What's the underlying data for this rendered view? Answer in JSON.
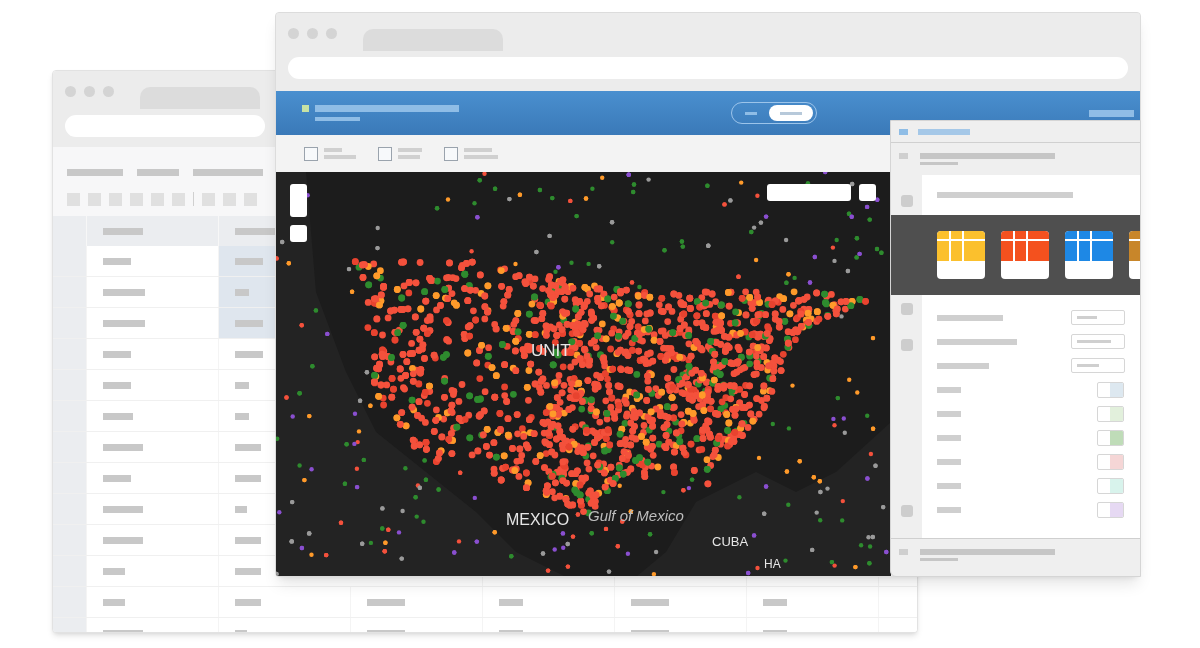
{
  "back_window": {
    "table": {
      "rows": [
        {
          "selected": true
        },
        {
          "selected": true
        },
        {
          "selected": true
        },
        {
          "selected": false
        },
        {
          "selected": false
        },
        {
          "selected": false
        },
        {
          "selected": false
        },
        {
          "selected": false
        },
        {
          "selected": false
        },
        {
          "selected": false
        },
        {
          "selected": false
        },
        {
          "selected": false
        },
        {
          "selected": false
        }
      ]
    }
  },
  "front_window": {
    "header": {
      "toggle": [
        {
          "selected": false
        },
        {
          "selected": true
        }
      ]
    },
    "filters": [
      {
        "checked": false
      },
      {
        "checked": false
      },
      {
        "checked": false
      }
    ],
    "map": {
      "labels": [
        {
          "text": "UNIT",
          "kind": "country"
        },
        {
          "text": "MEXICO",
          "kind": "country"
        },
        {
          "text": "Gulf of Mexico",
          "kind": "sea"
        },
        {
          "text": "CUBA",
          "kind": "country"
        },
        {
          "text": "HA",
          "kind": "country"
        }
      ]
    },
    "side_panel": {
      "themes": [
        {
          "color": "#fbc02d"
        },
        {
          "color": "#f4511e"
        },
        {
          "color": "#1e88e5"
        },
        {
          "color": "#c8862a"
        }
      ],
      "swatches": [
        {
          "color": "#dde8f0"
        },
        {
          "color": "#e2f0dc"
        },
        {
          "color": "#bfdcb8"
        },
        {
          "color": "#f5d6d6"
        },
        {
          "color": "#d8f3ec"
        },
        {
          "color": "#e6d9f3"
        }
      ]
    }
  }
}
